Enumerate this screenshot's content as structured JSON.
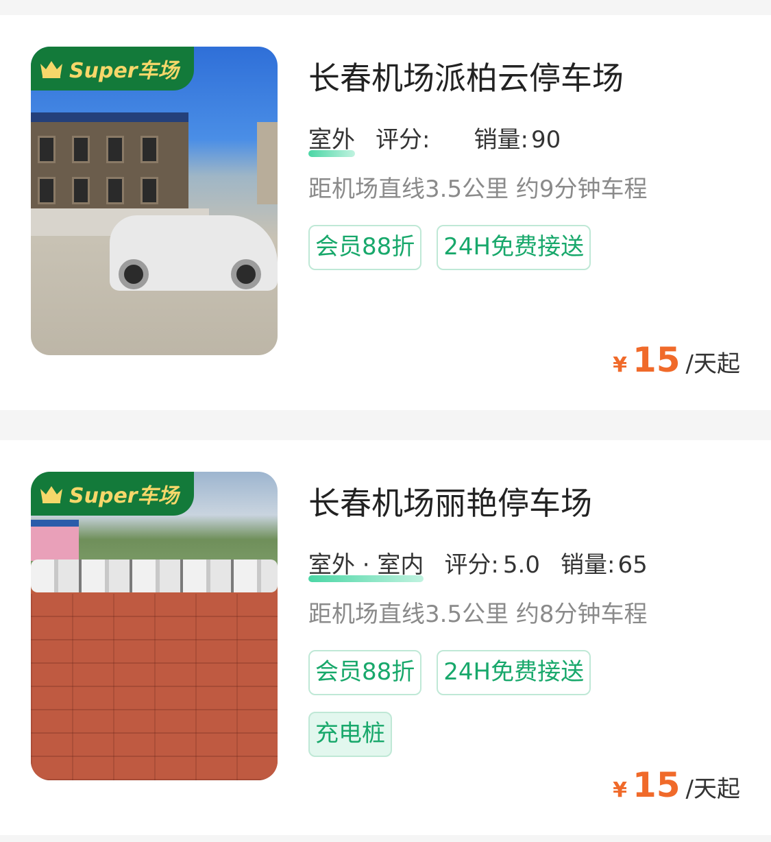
{
  "listings": [
    {
      "badge": "Super车场",
      "title": "长春机场派柏云停车场",
      "type": "室外",
      "rating_label": "评分:",
      "rating_value": "",
      "sales_label": "销量:",
      "sales_value": "90",
      "distance": "距机场直线3.5公里 约9分钟车程",
      "tags": [
        "会员88折",
        "24H免费接送"
      ],
      "price_currency": "¥",
      "price_value": "15",
      "price_unit": "/天起"
    },
    {
      "badge": "Super车场",
      "title": "长春机场丽艳停车场",
      "type": "室外 · 室内",
      "rating_label": "评分:",
      "rating_value": "5.0",
      "sales_label": "销量:",
      "sales_value": "65",
      "distance": "距机场直线3.5公里 约8分钟车程",
      "tags": [
        "会员88折",
        "24H免费接送",
        "充电桩"
      ],
      "price_currency": "¥",
      "price_value": "15",
      "price_unit": "/天起"
    }
  ],
  "colors": {
    "badge_bg": "#137a3a",
    "badge_text": "#f6d76a",
    "tag_text": "#18a86b",
    "tag_border": "#bfe8d6",
    "price": "#f06a2a"
  },
  "icons": {
    "badge_icon": "crown-icon"
  }
}
